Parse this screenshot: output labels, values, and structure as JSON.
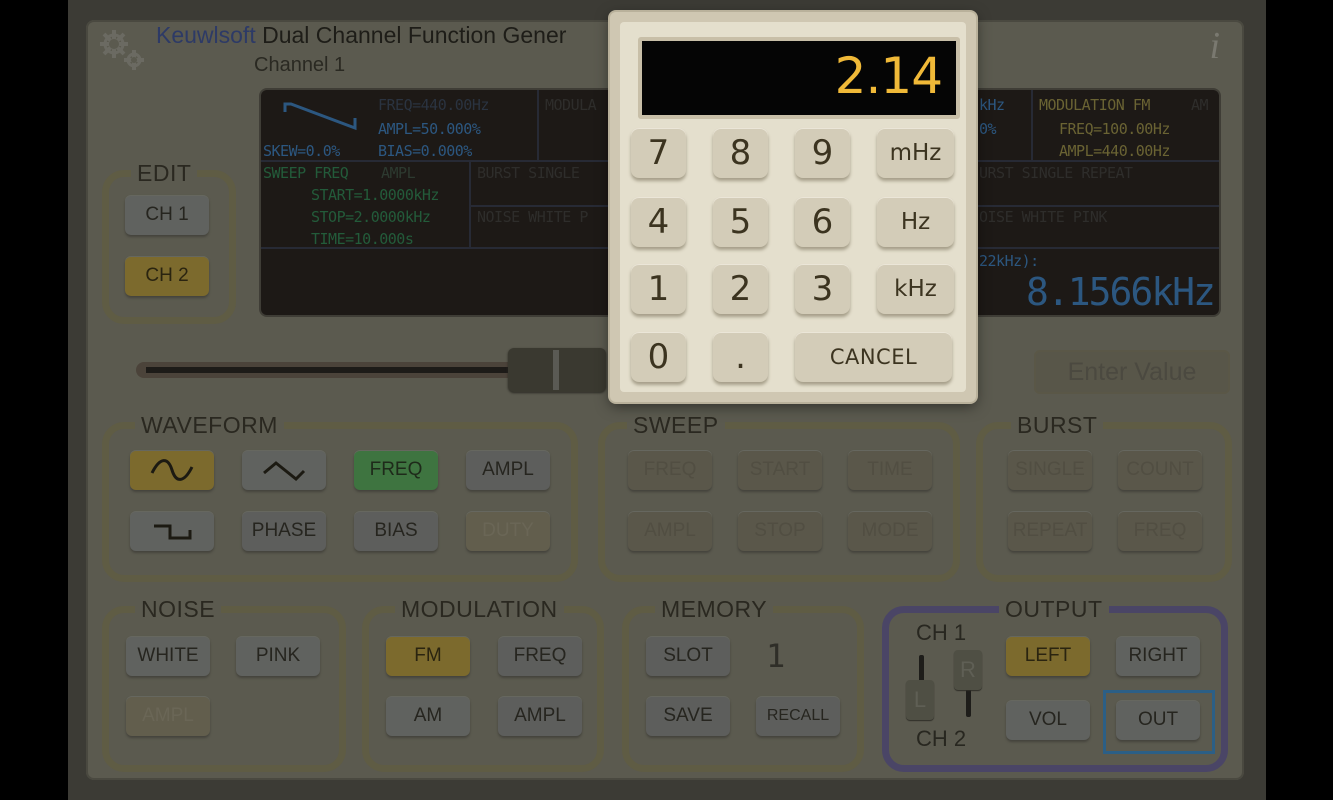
{
  "app": {
    "brand": "Keuwlsoft",
    "title": "Dual Channel Function Gener",
    "channel_label": "Channel 1",
    "info_icon": "i",
    "settings_icon": "gears-icon"
  },
  "lcd": {
    "waveform": {
      "skew": "SKEW=0.0%",
      "freq": "FREQ=440.00Hz",
      "ampl": "AMPL=50.000%",
      "bias": "BIAS=0.000%",
      "icon": "sawtooth-wave-icon"
    },
    "modulation_ch1": "MODULA",
    "sweep": {
      "header_active": "SWEEP  FREQ",
      "header_inactive": "AMPL",
      "start": "START=1.0000kHz",
      "stop": "STOP=2.0000kHz",
      "time": "TIME=10.000s"
    },
    "burst_ch1": "BURST  SINGLE",
    "noise_ch1": "NOISE  WHITE  P",
    "ch2_freq_partial": "kHz",
    "ch2_pct_partial": "0%",
    "modulation_ch2": {
      "header_active": "MODULATION FM",
      "header_inactive": "AM",
      "freq": "FREQ=100.00Hz",
      "ampl": "AMPL=440.00Hz"
    },
    "burst_ch2": "URST  SINGLE REPEAT",
    "noise_ch2": "OISE  WHITE  PINK",
    "range_partial": "22kHz):",
    "big_value": "8.1566kHz"
  },
  "edit": {
    "label": "EDIT",
    "ch1": "CH 1",
    "ch2": "CH 2"
  },
  "slider": {
    "position_fraction": 0.93
  },
  "enter_value_label": "Enter Value",
  "keypad": {
    "display": "2.14",
    "keys": [
      "7",
      "8",
      "9",
      "4",
      "5",
      "6",
      "1",
      "2",
      "3",
      "0",
      "."
    ],
    "units": [
      "mHz",
      "Hz",
      "kHz"
    ],
    "cancel": "CANCEL"
  },
  "waveform": {
    "label": "WAVEFORM",
    "sine_icon": "sine-wave-icon",
    "triangle_icon": "triangle-wave-icon",
    "square_icon": "square-wave-icon",
    "freq": "FREQ",
    "ampl": "AMPL",
    "phase": "PHASE",
    "bias": "BIAS",
    "duty": "DUTY"
  },
  "sweep": {
    "label": "SWEEP",
    "buttons": [
      "FREQ",
      "START",
      "TIME",
      "AMPL",
      "STOP",
      "MODE"
    ]
  },
  "burst": {
    "label": "BURST",
    "buttons": [
      "SINGLE",
      "COUNT",
      "REPEAT",
      "FREQ"
    ]
  },
  "noise": {
    "label": "NOISE",
    "white": "WHITE",
    "pink": "PINK",
    "ampl": "AMPL"
  },
  "modulation": {
    "label": "MODULATION",
    "fm": "FM",
    "freq": "FREQ",
    "am": "AM",
    "ampl": "AMPL"
  },
  "memory": {
    "label": "MEMORY",
    "slot": "SLOT",
    "slot_number": "1",
    "save": "SAVE",
    "recall": "RECALL"
  },
  "output": {
    "label": "OUTPUT",
    "ch1": "CH 1",
    "ch2": "CH 2",
    "l_knob": "L",
    "r_knob": "R",
    "left": "LEFT",
    "right": "RIGHT",
    "vol": "VOL",
    "out": "OUT"
  }
}
